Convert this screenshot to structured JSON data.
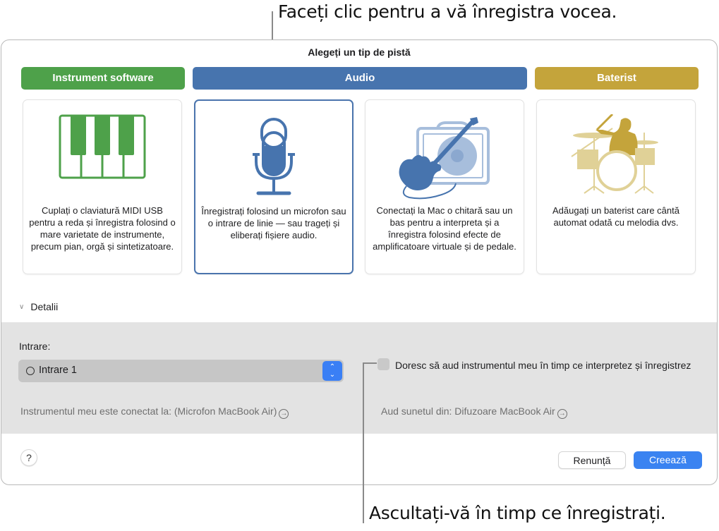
{
  "callouts": {
    "top": "Faceți clic pentru a vă înregistra vocea.",
    "bottom": "Ascultați-vă în timp ce înregistrați."
  },
  "dialog": {
    "title": "Alegeți un tip de pistă",
    "categories": [
      {
        "label": "Instrument software",
        "color": "#4ea14a"
      },
      {
        "label": "Audio",
        "color": "#4774ae"
      },
      {
        "label": "Baterist",
        "color": "#c4a43b"
      }
    ],
    "cards": [
      {
        "icon": "piano-keyboard-icon",
        "description": "Cuplați o claviatură MIDI USB pentru a reda și înregistra folosind o mare varietate de instrumente, precum pian, orgă și sintetizatoare.",
        "selected": false
      },
      {
        "icon": "microphone-icon",
        "description": "Înregistrați folosind un microfon sau o intrare de linie — sau trageți și eliberați fișiere audio.",
        "selected": true
      },
      {
        "icon": "guitar-amp-icon",
        "description": "Conectați la Mac o chitară sau un bas pentru a interpreta și a înregistra folosind efecte de amplificatoare virtuale și de pedale.",
        "selected": false
      },
      {
        "icon": "drummer-icon",
        "description": "Adăugați un baterist care cântă automat odată cu melodia dvs.",
        "selected": false
      }
    ],
    "details": {
      "toggle_label": "Detalii",
      "input_label": "Intrare:",
      "input_value": "Intrare 1",
      "connected_to": "Instrumentul meu este conectat la: (Microfon MacBook Air)",
      "monitor_checkbox_label": "Doresc să aud instrumentul meu în timp ce interpretez și înregistrez",
      "monitor_checked": false,
      "hear_from": "Aud sunetul din: Difuzoare MacBook Air"
    },
    "footer": {
      "help_label": "?",
      "cancel_label": "Renunță",
      "create_label": "Creează"
    }
  }
}
